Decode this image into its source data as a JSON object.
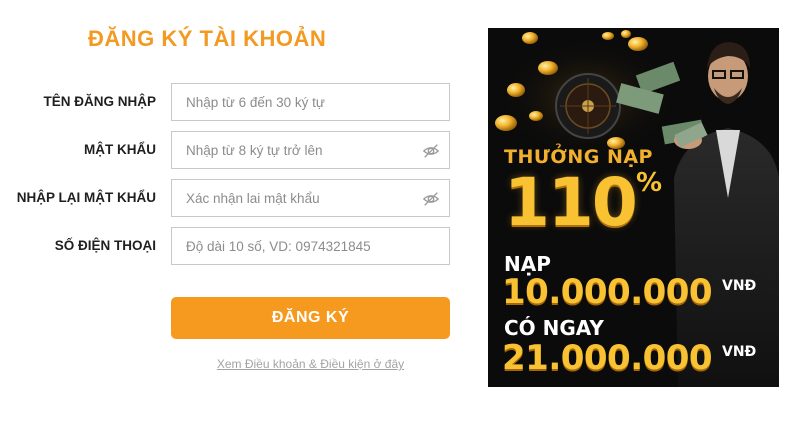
{
  "form": {
    "title": "ĐĂNG KÝ TÀI KHOẢN",
    "fields": [
      {
        "label": "TÊN ĐĂNG NHẬP",
        "placeholder": "Nhập từ 6 đến 30 ký tự",
        "value": ""
      },
      {
        "label": "MẬT KHẨU",
        "placeholder": "Nhập từ 8 ký tự trở lên",
        "value": "",
        "icon": "eye-hidden-icon"
      },
      {
        "label": "NHẬP LẠI MẬT KHẨU",
        "placeholder": "Xác nhận lai mật khẩu",
        "value": "",
        "icon": "eye-hidden-icon"
      },
      {
        "label": "SỐ ĐIỆN THOẠI",
        "placeholder": "Độ dài 10 số, VD: 0974321845",
        "value": ""
      }
    ],
    "submit_label": "ĐĂNG KÝ",
    "terms_link": "Xem Điều khoản & Điều kiện ở đây"
  },
  "banner": {
    "bonus_label": "THƯỞNG NẠP",
    "bonus_value": "110",
    "bonus_unit": "%",
    "deposit_label": "NẠP",
    "deposit_amount": "10.000.000",
    "deposit_currency": "VNĐ",
    "receive_label": "CÓ NGAY",
    "receive_amount": "21.000.000",
    "receive_currency": "VNĐ"
  },
  "colors": {
    "accent": "#f6991f",
    "title": "#f39a23",
    "banner_bg": "#0b0b0b",
    "banner_gold": "#f8c233"
  }
}
